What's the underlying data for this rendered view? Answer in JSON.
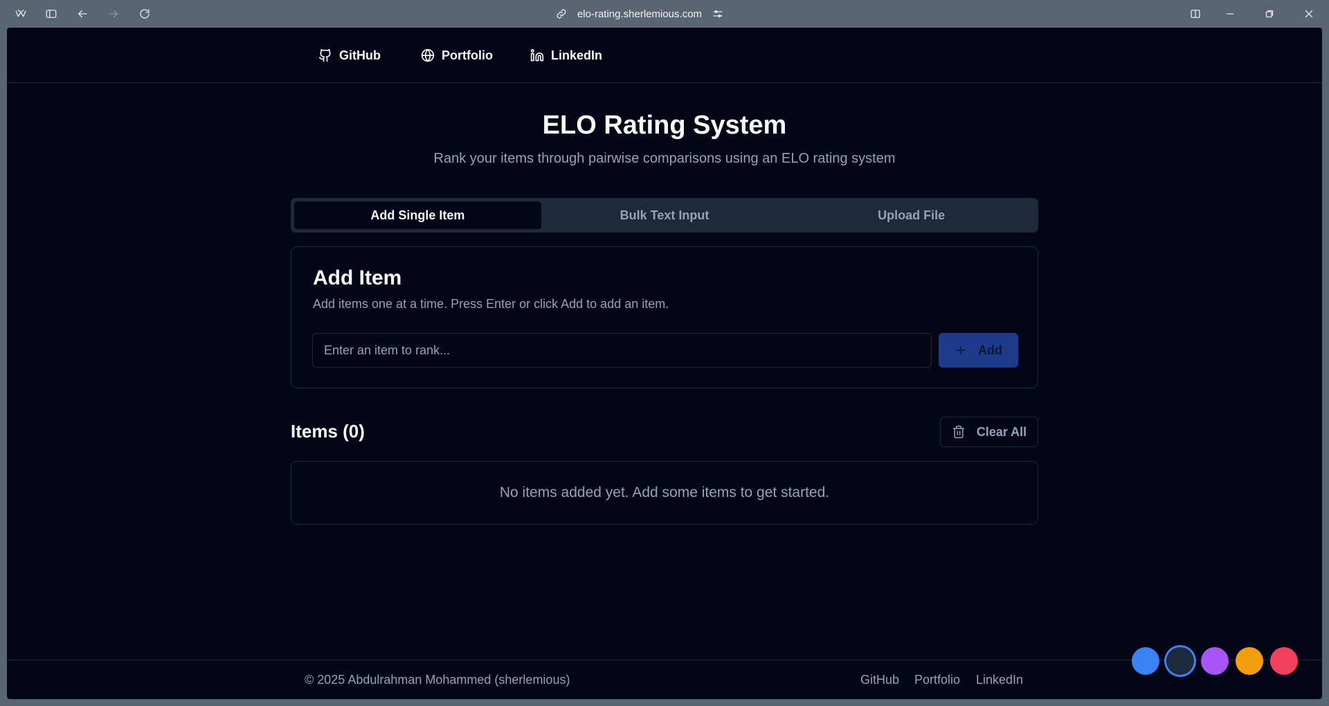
{
  "browser": {
    "url": "elo-rating.sherlemious.com"
  },
  "nav": {
    "github": "GitHub",
    "portfolio": "Portfolio",
    "linkedin": "LinkedIn"
  },
  "header": {
    "title": "ELO Rating System",
    "subtitle": "Rank your items through pairwise comparisons using an ELO rating system"
  },
  "tabs": [
    {
      "label": "Add Single Item",
      "active": true
    },
    {
      "label": "Bulk Text Input",
      "active": false
    },
    {
      "label": "Upload File",
      "active": false
    }
  ],
  "add_card": {
    "title": "Add Item",
    "description": "Add items one at a time. Press Enter or click Add to add an item.",
    "input_placeholder": "Enter an item to rank...",
    "input_value": "",
    "add_label": "Add"
  },
  "items": {
    "title": "Items (0)",
    "clear_label": "Clear All",
    "empty_message": "No items added yet. Add some items to get started."
  },
  "footer": {
    "copyright": "© 2025 Abdulrahman Mohammed (sherlemious)",
    "links": [
      "GitHub",
      "Portfolio",
      "LinkedIn"
    ]
  },
  "theme_swatches": [
    {
      "name": "blue",
      "color": "#3b82f6",
      "selected": false
    },
    {
      "name": "slate",
      "color": "#1e293b",
      "selected": true
    },
    {
      "name": "purple",
      "color": "#a855f7",
      "selected": false
    },
    {
      "name": "amber",
      "color": "#f59e0b",
      "selected": false
    },
    {
      "name": "rose",
      "color": "#f43f5e",
      "selected": false
    }
  ],
  "colors": {
    "background": "#020617",
    "border": "#1e293b",
    "muted_text": "#94a3b8",
    "primary_button": "#1e3a8a"
  }
}
